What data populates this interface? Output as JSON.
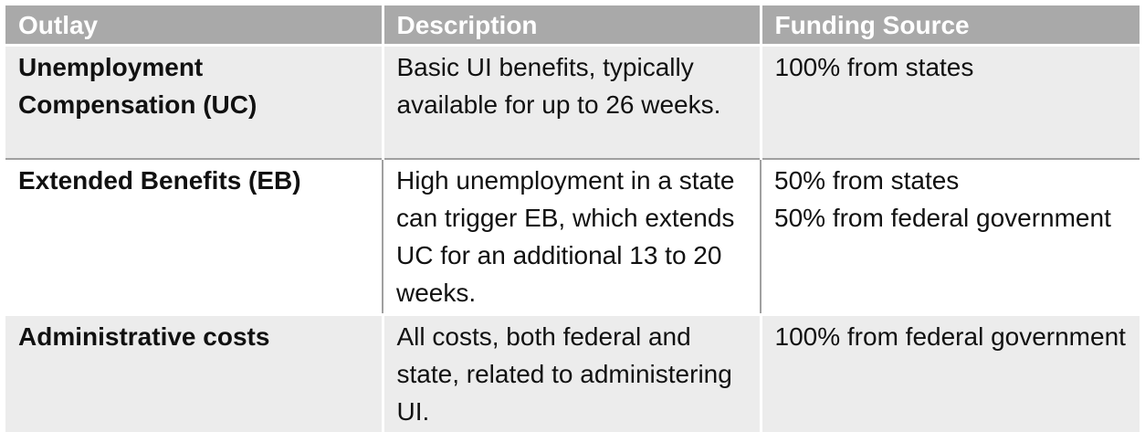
{
  "table": {
    "headers": [
      "Outlay",
      "Description",
      "Funding Source"
    ],
    "rows": [
      {
        "outlay": "Unemployment Compensation (UC)",
        "description": "Basic UI benefits, typically available for up to 26 weeks.",
        "funding": [
          "100% from states"
        ]
      },
      {
        "outlay": "Extended Benefits (EB)",
        "description": "High unemployment in a state can trigger EB, which extends UC for an additional 13 to 20 weeks.",
        "funding": [
          "50% from states",
          "50% from federal government"
        ]
      },
      {
        "outlay": "Administrative costs",
        "description": "All costs, both federal and state, related to administering UI.",
        "funding": [
          "100% from federal government"
        ]
      }
    ]
  },
  "colors": {
    "header_bg": "#a9a9a9",
    "header_text": "#ffffff",
    "shaded_row_bg": "#ececec",
    "plain_row_bg": "#ffffff"
  }
}
